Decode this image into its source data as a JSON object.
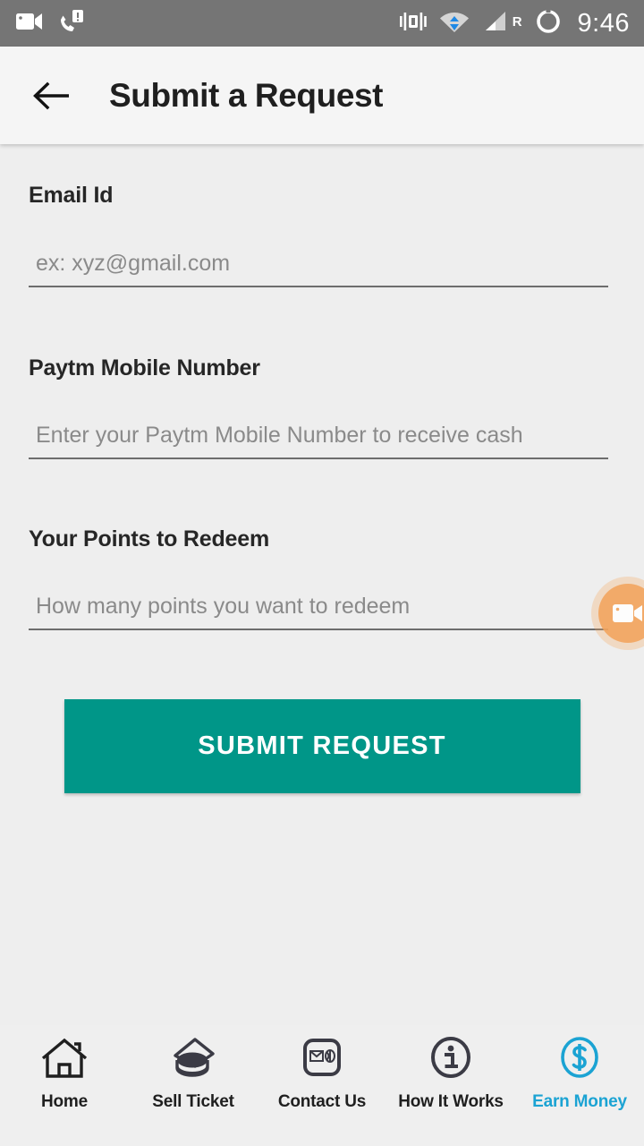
{
  "status_bar": {
    "icons_left": [
      "video-camera-icon",
      "phone-missed-call-icon"
    ],
    "icons_right": [
      "vibrate-icon",
      "wifi-icon",
      "cellular-signal-icon",
      "battery-circle-icon"
    ],
    "roaming_letter": "R",
    "clock": "9:46",
    "background_color": "#757575"
  },
  "app_bar": {
    "back_icon": "back-arrow-icon",
    "title": "Submit a Request",
    "background_color": "#F5F5F5"
  },
  "form": {
    "fields": [
      {
        "label": "Email Id",
        "placeholder": "ex: xyz@gmail.com",
        "value": ""
      },
      {
        "label": "Paytm Mobile Number",
        "placeholder": "Enter your Paytm Mobile Number to receive cash",
        "value": ""
      },
      {
        "label": "Your Points to Redeem",
        "placeholder": "How many points you want to redeem",
        "value": ""
      }
    ],
    "submit_label": "SUBMIT REQUEST",
    "submit_color": "#009688"
  },
  "floating_button": {
    "icon": "video-camera-icon",
    "color": "#F3A55E"
  },
  "bottom_nav": {
    "active_color": "#1BA3D3",
    "items": [
      {
        "label": "Home",
        "icon": "home-icon",
        "active": false
      },
      {
        "label": "Sell Ticket",
        "icon": "ticket-coins-icon",
        "active": false
      },
      {
        "label": "Contact Us",
        "icon": "mail-phone-icon",
        "active": false
      },
      {
        "label": "How It Works",
        "icon": "info-circle-icon",
        "active": false
      },
      {
        "label": "Earn Money",
        "icon": "dollar-coin-icon",
        "active": true
      }
    ]
  }
}
